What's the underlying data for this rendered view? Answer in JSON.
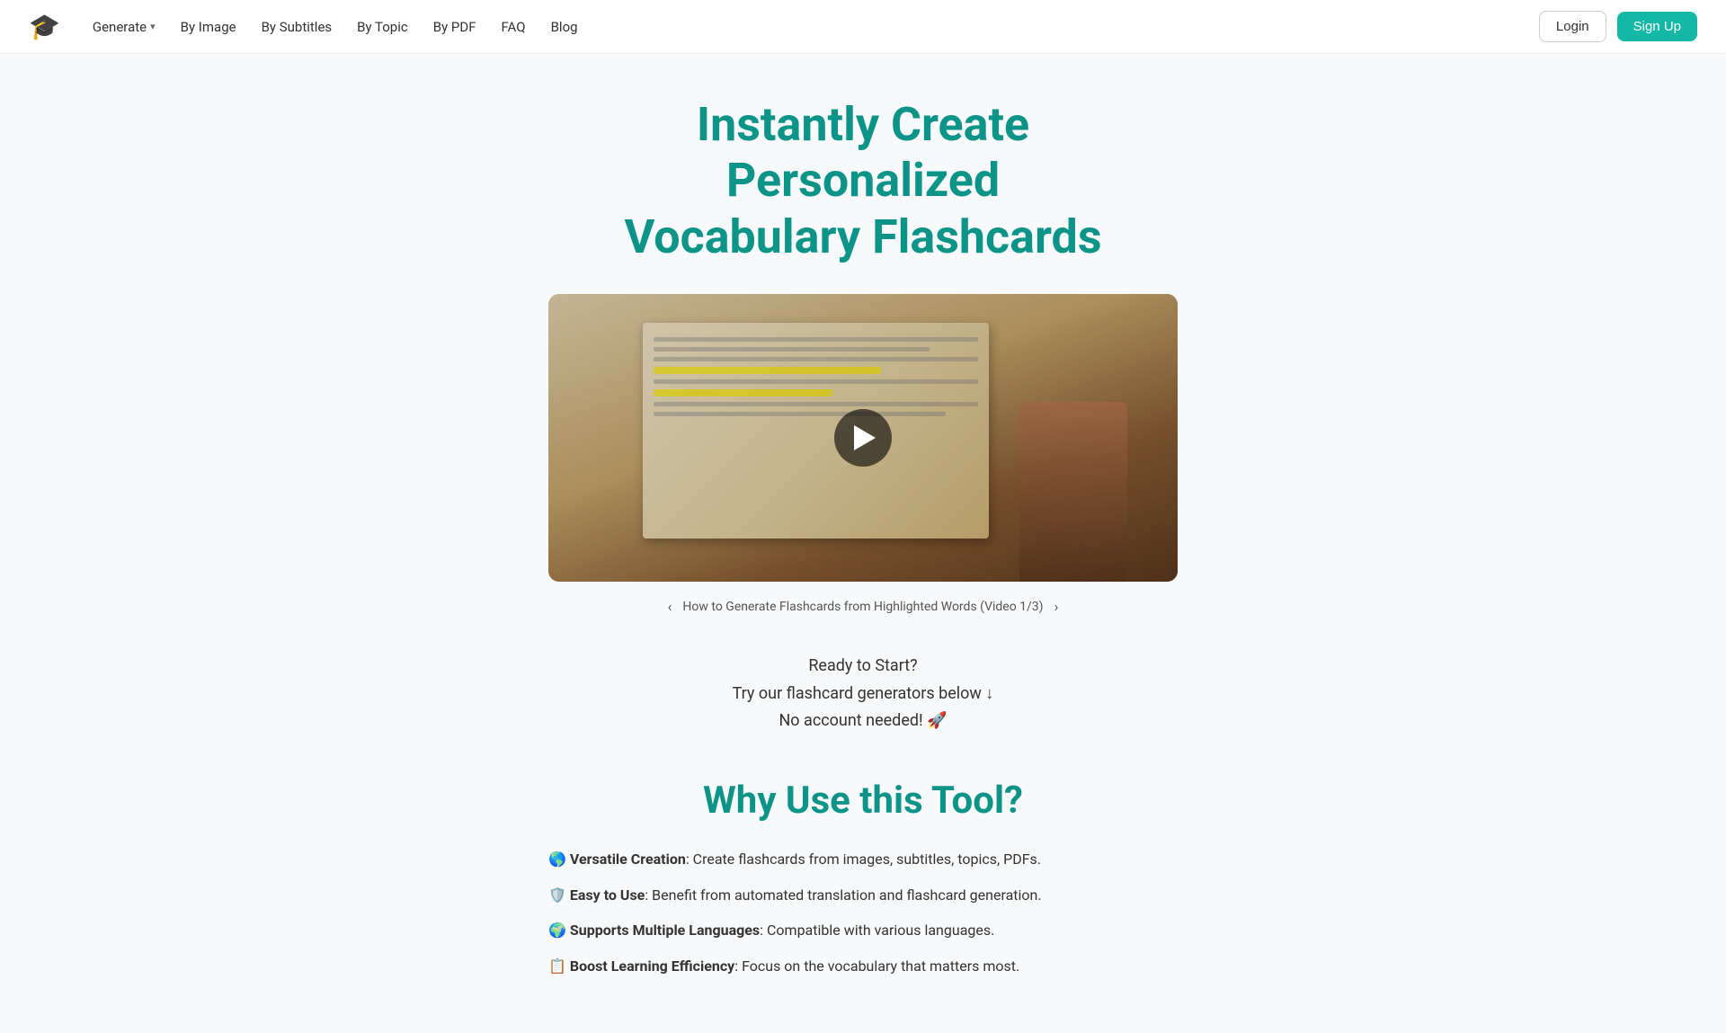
{
  "navbar": {
    "logo_emoji": "🎓",
    "generate_label": "Generate",
    "nav_items": [
      {
        "id": "by-image",
        "label": "By Image"
      },
      {
        "id": "by-subtitles",
        "label": "By Subtitles"
      },
      {
        "id": "by-topic",
        "label": "By Topic"
      },
      {
        "id": "by-pdf",
        "label": "By PDF"
      },
      {
        "id": "faq",
        "label": "FAQ"
      },
      {
        "id": "blog",
        "label": "Blog"
      }
    ],
    "login_label": "Login",
    "signup_label": "Sign Up"
  },
  "hero": {
    "title_line1": "Instantly Create",
    "title_line2": "Personalized",
    "title_line3": "Vocabulary Flashcards"
  },
  "video": {
    "prev_arrow": "‹",
    "caption": "How to Generate Flashcards from Highlighted Words (Video 1/3)",
    "next_arrow": "›"
  },
  "ready_section": {
    "line1": "Ready to Start?",
    "line2": "Try our flashcard generators below ↓",
    "line3": "No account needed! 🚀"
  },
  "why_section": {
    "title": "Why Use this Tool?",
    "features": [
      {
        "emoji": "🌎",
        "title": "Versatile Creation",
        "description": ": Create flashcards from images, subtitles, topics, PDFs."
      },
      {
        "emoji": "🛡️",
        "title": "Easy to Use",
        "description": ": Benefit from automated translation and flashcard generation."
      },
      {
        "emoji": "🌍",
        "title": "Supports Multiple Languages",
        "description": ": Compatible with various languages."
      },
      {
        "emoji": "📋",
        "title": "Boost Learning Efficiency",
        "description": ": Focus on the vocabulary that matters most."
      }
    ]
  }
}
